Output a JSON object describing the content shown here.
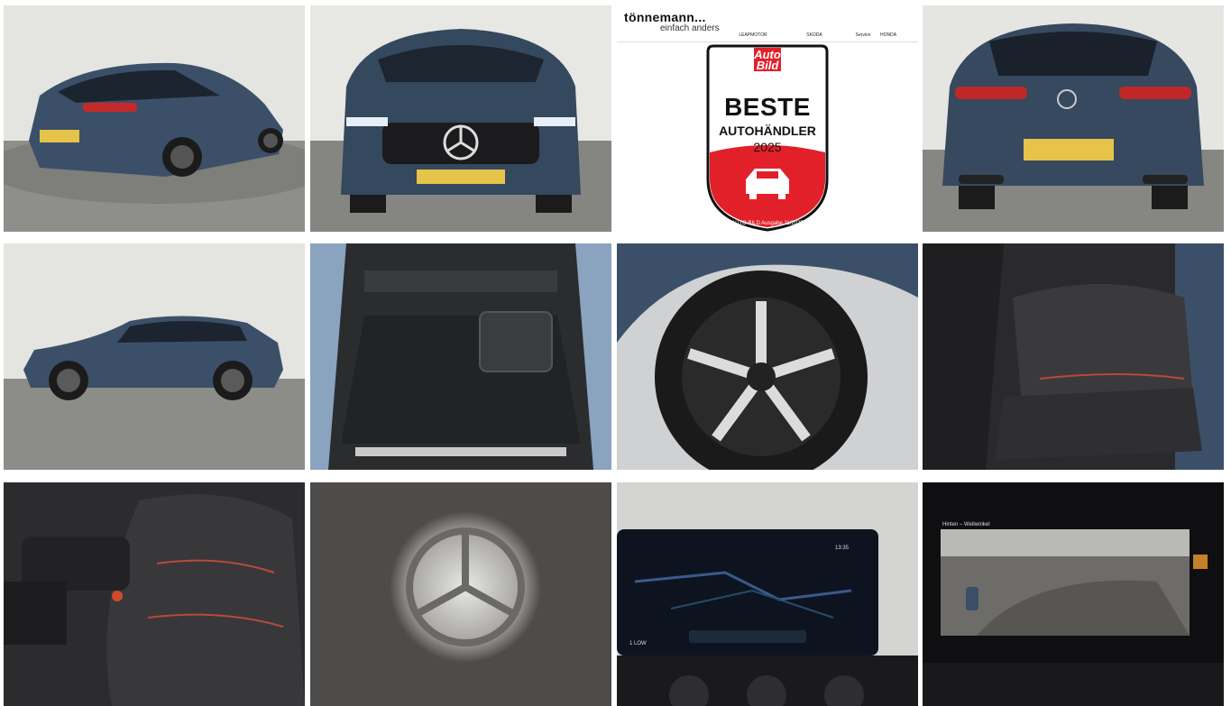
{
  "gallery": {
    "tiles": [
      {
        "name": "rear-three-quarter-photo",
        "kind": "photo"
      },
      {
        "name": "front-view-photo",
        "kind": "photo"
      },
      {
        "name": "dealer-award-ad",
        "kind": "ad"
      },
      {
        "name": "rear-view-photo",
        "kind": "photo"
      },
      {
        "name": "side-profile-photo",
        "kind": "photo"
      },
      {
        "name": "trunk-photo",
        "kind": "photo"
      },
      {
        "name": "wheel-photo",
        "kind": "photo"
      },
      {
        "name": "rear-seats-photo",
        "kind": "photo"
      },
      {
        "name": "front-seat-photo",
        "kind": "photo"
      },
      {
        "name": "puddle-light-logo-photo",
        "kind": "photo"
      },
      {
        "name": "navigation-screen-photo",
        "kind": "photo"
      },
      {
        "name": "rear-camera-screen-photo",
        "kind": "photo"
      }
    ]
  },
  "ad": {
    "dealer_name": "tönnemann...",
    "slogan": "einfach anders",
    "brands": [
      "LEAPMOTOR",
      "SKODA",
      "Service",
      "HONDA"
    ],
    "magazine_line1": "Auto",
    "magazine_line2": "Bild",
    "badge_title": "BESTE",
    "badge_subtitle": "AUTOHÄNDLER",
    "badge_year": "2025",
    "badge_footnote": "AUTO BILD Ausgabe 11/2025"
  },
  "screens": {
    "nav_time": "13:35",
    "nav_range": "1 LOW",
    "camera_title": "Hinten – Weitwinkel"
  },
  "colors": {
    "car_blue": "#3b5068",
    "studio_wall": "#e6e6e3",
    "studio_floor": "#8a8a86",
    "badge_red": "#e2202a",
    "interior_dark": "#2a2a2c"
  }
}
